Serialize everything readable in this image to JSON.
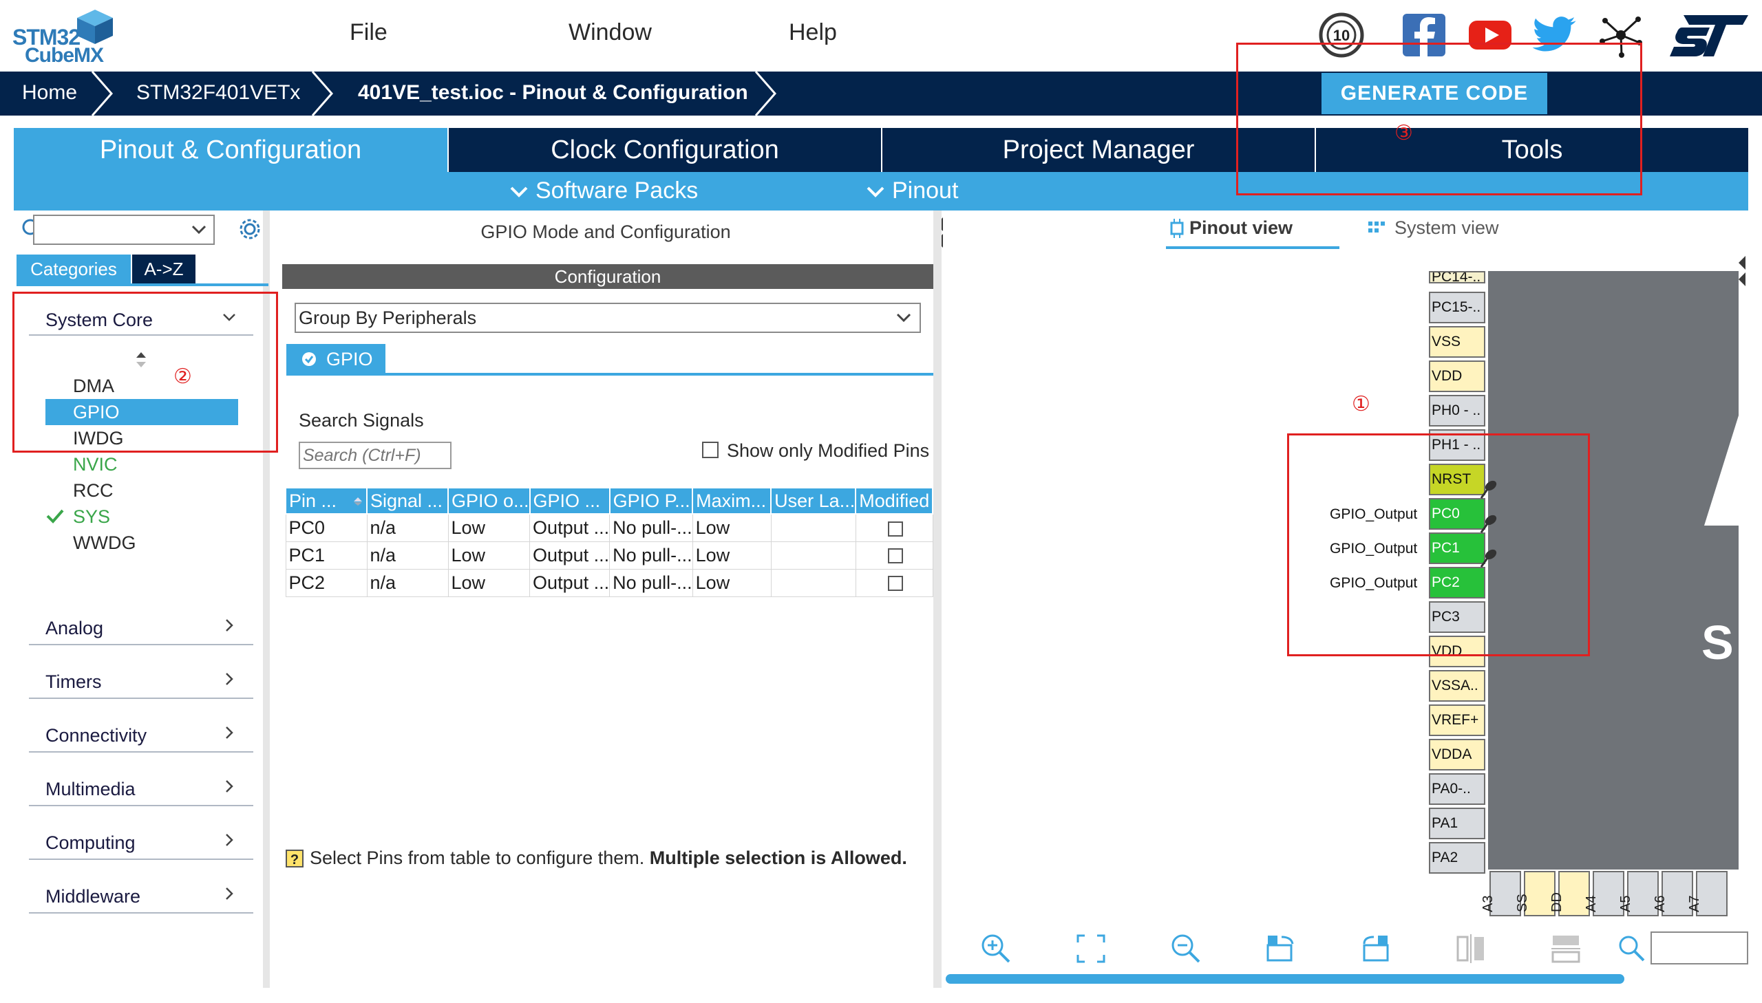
{
  "app": {
    "logo_line1": "STM32",
    "logo_line2": "CubeMX"
  },
  "menu": {
    "file": "File",
    "window": "Window",
    "help": "Help"
  },
  "breadcrumb": {
    "home": "Home",
    "device": "STM32F401VETx",
    "project": "401VE_test.ioc - Pinout & Configuration"
  },
  "generate_button": "GENERATE CODE",
  "tabs": [
    {
      "label": "Pinout & Configuration"
    },
    {
      "label": "Clock Configuration"
    },
    {
      "label": "Project Manager"
    },
    {
      "label": "Tools"
    }
  ],
  "subtabs": {
    "software_packs": "Software Packs",
    "pinout": "Pinout"
  },
  "left": {
    "tab_categories": "Categories",
    "tab_az": "A->Z",
    "system_core": "System Core",
    "core_items": [
      {
        "label": "DMA",
        "color": "#2a2a2a",
        "checked": false
      },
      {
        "label": "GPIO",
        "color": "#ffffff",
        "checked": false
      },
      {
        "label": "IWDG",
        "color": "#2a2a2a",
        "checked": false
      },
      {
        "label": "NVIC",
        "color": "#3aa64a",
        "checked": false
      },
      {
        "label": "RCC",
        "color": "#2a2a2a",
        "checked": false
      },
      {
        "label": "SYS",
        "color": "#3aa64a",
        "checked": true
      },
      {
        "label": "WWDG",
        "color": "#2a2a2a",
        "checked": false
      }
    ],
    "categories": [
      "Analog",
      "Timers",
      "Connectivity",
      "Multimedia",
      "Computing",
      "Middleware"
    ]
  },
  "middle": {
    "header": "GPIO Mode and Configuration",
    "config_header": "Configuration",
    "group_by": "Group By Peripherals",
    "gpio_tab": "GPIO",
    "search_label": "Search Signals",
    "search_placeholder": "Search (Ctrl+F)",
    "show_modified": "Show only Modified Pins",
    "columns": [
      "Pin ...",
      "Signal ...",
      "GPIO o...",
      "GPIO ...",
      "GPIO P...",
      "Maxim...",
      "User La...",
      "Modified"
    ],
    "rows": [
      [
        "PC0",
        "n/a",
        "Low",
        "Output ...",
        "No pull-...",
        "Low",
        ""
      ],
      [
        "PC1",
        "n/a",
        "Low",
        "Output ...",
        "No pull-...",
        "Low",
        ""
      ],
      [
        "PC2",
        "n/a",
        "Low",
        "Output ...",
        "No pull-...",
        "Low",
        ""
      ]
    ],
    "hint_normal": "Select Pins from table to configure them.",
    "hint_bold": "Multiple selection is Allowed."
  },
  "right": {
    "pinout_view": "Pinout view",
    "system_view": "System view",
    "pins": [
      {
        "label": "PC14-..",
        "color": "#f5f0cc"
      },
      {
        "label": "PC15-..",
        "color": "#d9dce0"
      },
      {
        "label": "VSS",
        "color": "#fff3bf"
      },
      {
        "label": "VDD",
        "color": "#fff3bf"
      },
      {
        "label": "PH0 - ..",
        "color": "#d9dce0"
      },
      {
        "label": "PH1 - ..",
        "color": "#d9dce0"
      },
      {
        "label": "NRST",
        "color": "#c6d626"
      },
      {
        "label": "PC0",
        "color": "#27c13a"
      },
      {
        "label": "PC1",
        "color": "#27c13a"
      },
      {
        "label": "PC2",
        "color": "#27c13a"
      },
      {
        "label": "PC3",
        "color": "#d9dce0"
      },
      {
        "label": "VDD",
        "color": "#fff3bf"
      },
      {
        "label": "VSSA..",
        "color": "#fff3bf"
      },
      {
        "label": "VREF+",
        "color": "#fff3bf"
      },
      {
        "label": "VDDA",
        "color": "#fff3bf"
      },
      {
        "label": "PA0-..",
        "color": "#d9dce0"
      },
      {
        "label": "PA1",
        "color": "#d9dce0"
      },
      {
        "label": "PA2",
        "color": "#d9dce0"
      }
    ],
    "outputs": [
      "GPIO_Output",
      "GPIO_Output",
      "GPIO_Output"
    ],
    "bottom_pins": [
      "A3",
      "SS",
      "DD",
      "A4",
      "A5",
      "A6",
      "A7"
    ],
    "chip_letter": "S"
  },
  "annotations": {
    "one": "①",
    "two": "②",
    "three": "③"
  },
  "colors": {
    "navy": "#03234b",
    "accent": "#3ca7e0",
    "annotation": "#e02020",
    "configured_pin": "#27c13a"
  }
}
